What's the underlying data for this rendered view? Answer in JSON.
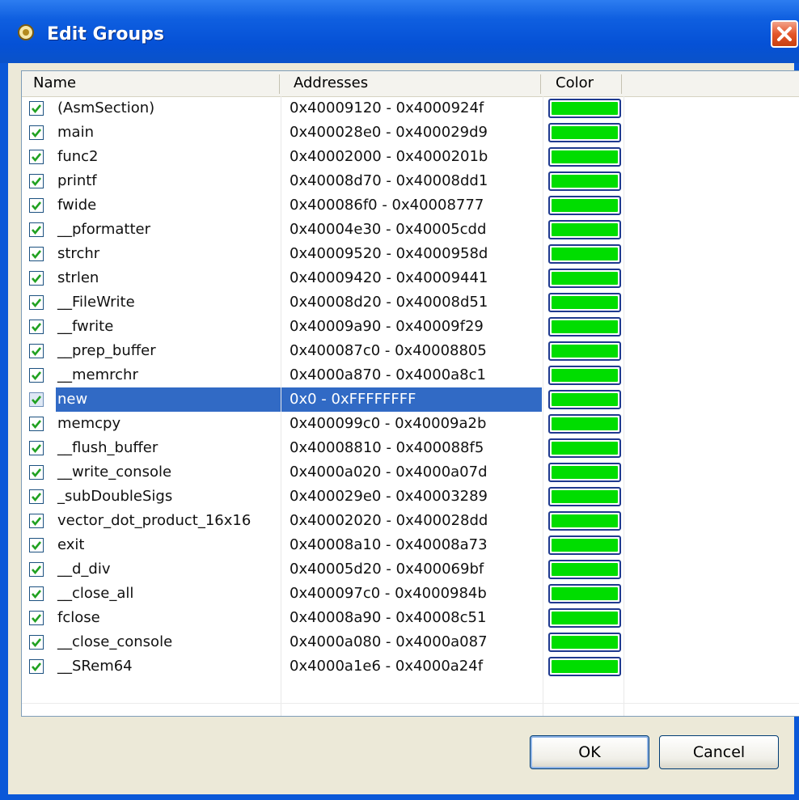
{
  "window": {
    "title": "Edit Groups"
  },
  "table": {
    "columns": [
      "Name",
      "Addresses",
      "Color"
    ],
    "selected_index": 12,
    "rows": [
      {
        "name": "(AsmSection)",
        "addresses": "0x40009120 - 0x4000924f",
        "checked": true
      },
      {
        "name": "main",
        "addresses": "0x400028e0 - 0x400029d9",
        "checked": true
      },
      {
        "name": "func2",
        "addresses": "0x40002000 - 0x4000201b",
        "checked": true
      },
      {
        "name": "printf",
        "addresses": "0x40008d70 - 0x40008dd1",
        "checked": true
      },
      {
        "name": "fwide",
        "addresses": "0x400086f0 - 0x40008777",
        "checked": true
      },
      {
        "name": "__pformatter",
        "addresses": "0x40004e30 - 0x40005cdd",
        "checked": true
      },
      {
        "name": "strchr",
        "addresses": "0x40009520 - 0x4000958d",
        "checked": true
      },
      {
        "name": "strlen",
        "addresses": "0x40009420 - 0x40009441",
        "checked": true
      },
      {
        "name": "__FileWrite",
        "addresses": "0x40008d20 - 0x40008d51",
        "checked": true
      },
      {
        "name": "__fwrite",
        "addresses": "0x40009a90 - 0x40009f29",
        "checked": true
      },
      {
        "name": "__prep_buffer",
        "addresses": "0x400087c0 - 0x40008805",
        "checked": true
      },
      {
        "name": "__memrchr",
        "addresses": "0x4000a870 - 0x4000a8c1",
        "checked": true
      },
      {
        "name": "new",
        "addresses": "0x0 - 0xFFFFFFFF",
        "checked": true
      },
      {
        "name": "memcpy",
        "addresses": "0x400099c0 - 0x40009a2b",
        "checked": true
      },
      {
        "name": "__flush_buffer",
        "addresses": "0x40008810 - 0x400088f5",
        "checked": true
      },
      {
        "name": "__write_console",
        "addresses": "0x4000a020 - 0x4000a07d",
        "checked": true
      },
      {
        "name": "_subDoubleSigs",
        "addresses": "0x400029e0 - 0x40003289",
        "checked": true
      },
      {
        "name": "vector_dot_product_16x16",
        "addresses": "0x40002020 - 0x400028dd",
        "checked": true
      },
      {
        "name": "exit",
        "addresses": "0x40008a10 - 0x40008a73",
        "checked": true
      },
      {
        "name": "__d_div",
        "addresses": "0x40005d20 - 0x400069bf",
        "checked": true
      },
      {
        "name": "__close_all",
        "addresses": "0x400097c0 - 0x4000984b",
        "checked": true
      },
      {
        "name": "fclose",
        "addresses": "0x40008a90 - 0x40008c51",
        "checked": true
      },
      {
        "name": "__close_console",
        "addresses": "0x4000a080 - 0x4000a087",
        "checked": true
      },
      {
        "name": "__SRem64",
        "addresses": "0x4000a1e6 - 0x4000a24f",
        "checked": true
      }
    ]
  },
  "colors": {
    "group_color": "#00dd00",
    "selection": "#316ac5",
    "checkmark": "#21a121"
  },
  "buttons": {
    "ok": "OK",
    "cancel": "Cancel"
  }
}
